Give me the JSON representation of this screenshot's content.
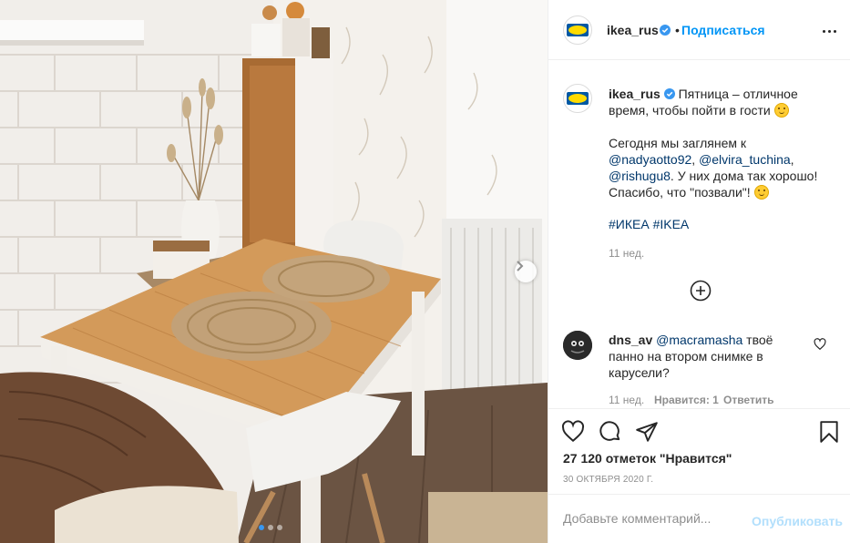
{
  "post": {
    "account": "ikea_rus",
    "follow_label": "Подписаться",
    "separator": "•",
    "caption_line1": "Пятница – отличное",
    "caption_line2": "время, чтобы пойти в гости",
    "caption_line3": "Сегодня мы заглянем к",
    "mention1": "@nadyaotto92",
    "mention2": "@elvira_tuchina",
    "mention3": "@rishugu8",
    "caption_line5_rest": ". У них дома так хорошо!",
    "caption_line6": "Спасибо, что \"позвали\"!",
    "comma": ",",
    "hashtag1": "#ИКЕА",
    "hashtag2": "#IKEA",
    "caption_time": "11 нед."
  },
  "comment": {
    "user": "dns_av",
    "mention": "@macramasha",
    "text1": "твоё",
    "text2": "панно на втором снимке в",
    "text3": "карусели?",
    "time": "11 нед.",
    "likes": "Нравится: 1",
    "reply": "Ответить"
  },
  "engagement": {
    "likes_label": "27 120 отметок \"Нравится\"",
    "date": "30 ОКТЯБРЯ 2020 Г."
  },
  "composer": {
    "placeholder": "Добавьте комментарий...",
    "publish_label": "Опубликовать"
  },
  "carousel": {
    "current_index": 1,
    "total": 3
  },
  "colors": {
    "accent": "#0095f6",
    "verified": "#3897f0",
    "link": "#00376b",
    "muted": "#8e8e8e",
    "publish_disabled": "#b2dffc"
  },
  "icons": {
    "verified": "verified-badge-icon",
    "more": "more-options-icon",
    "add": "plus-circle-icon",
    "like": "heart-icon",
    "comment": "comment-bubble-icon",
    "share": "paper-plane-icon",
    "save": "bookmark-icon",
    "next": "chevron-right-icon"
  }
}
